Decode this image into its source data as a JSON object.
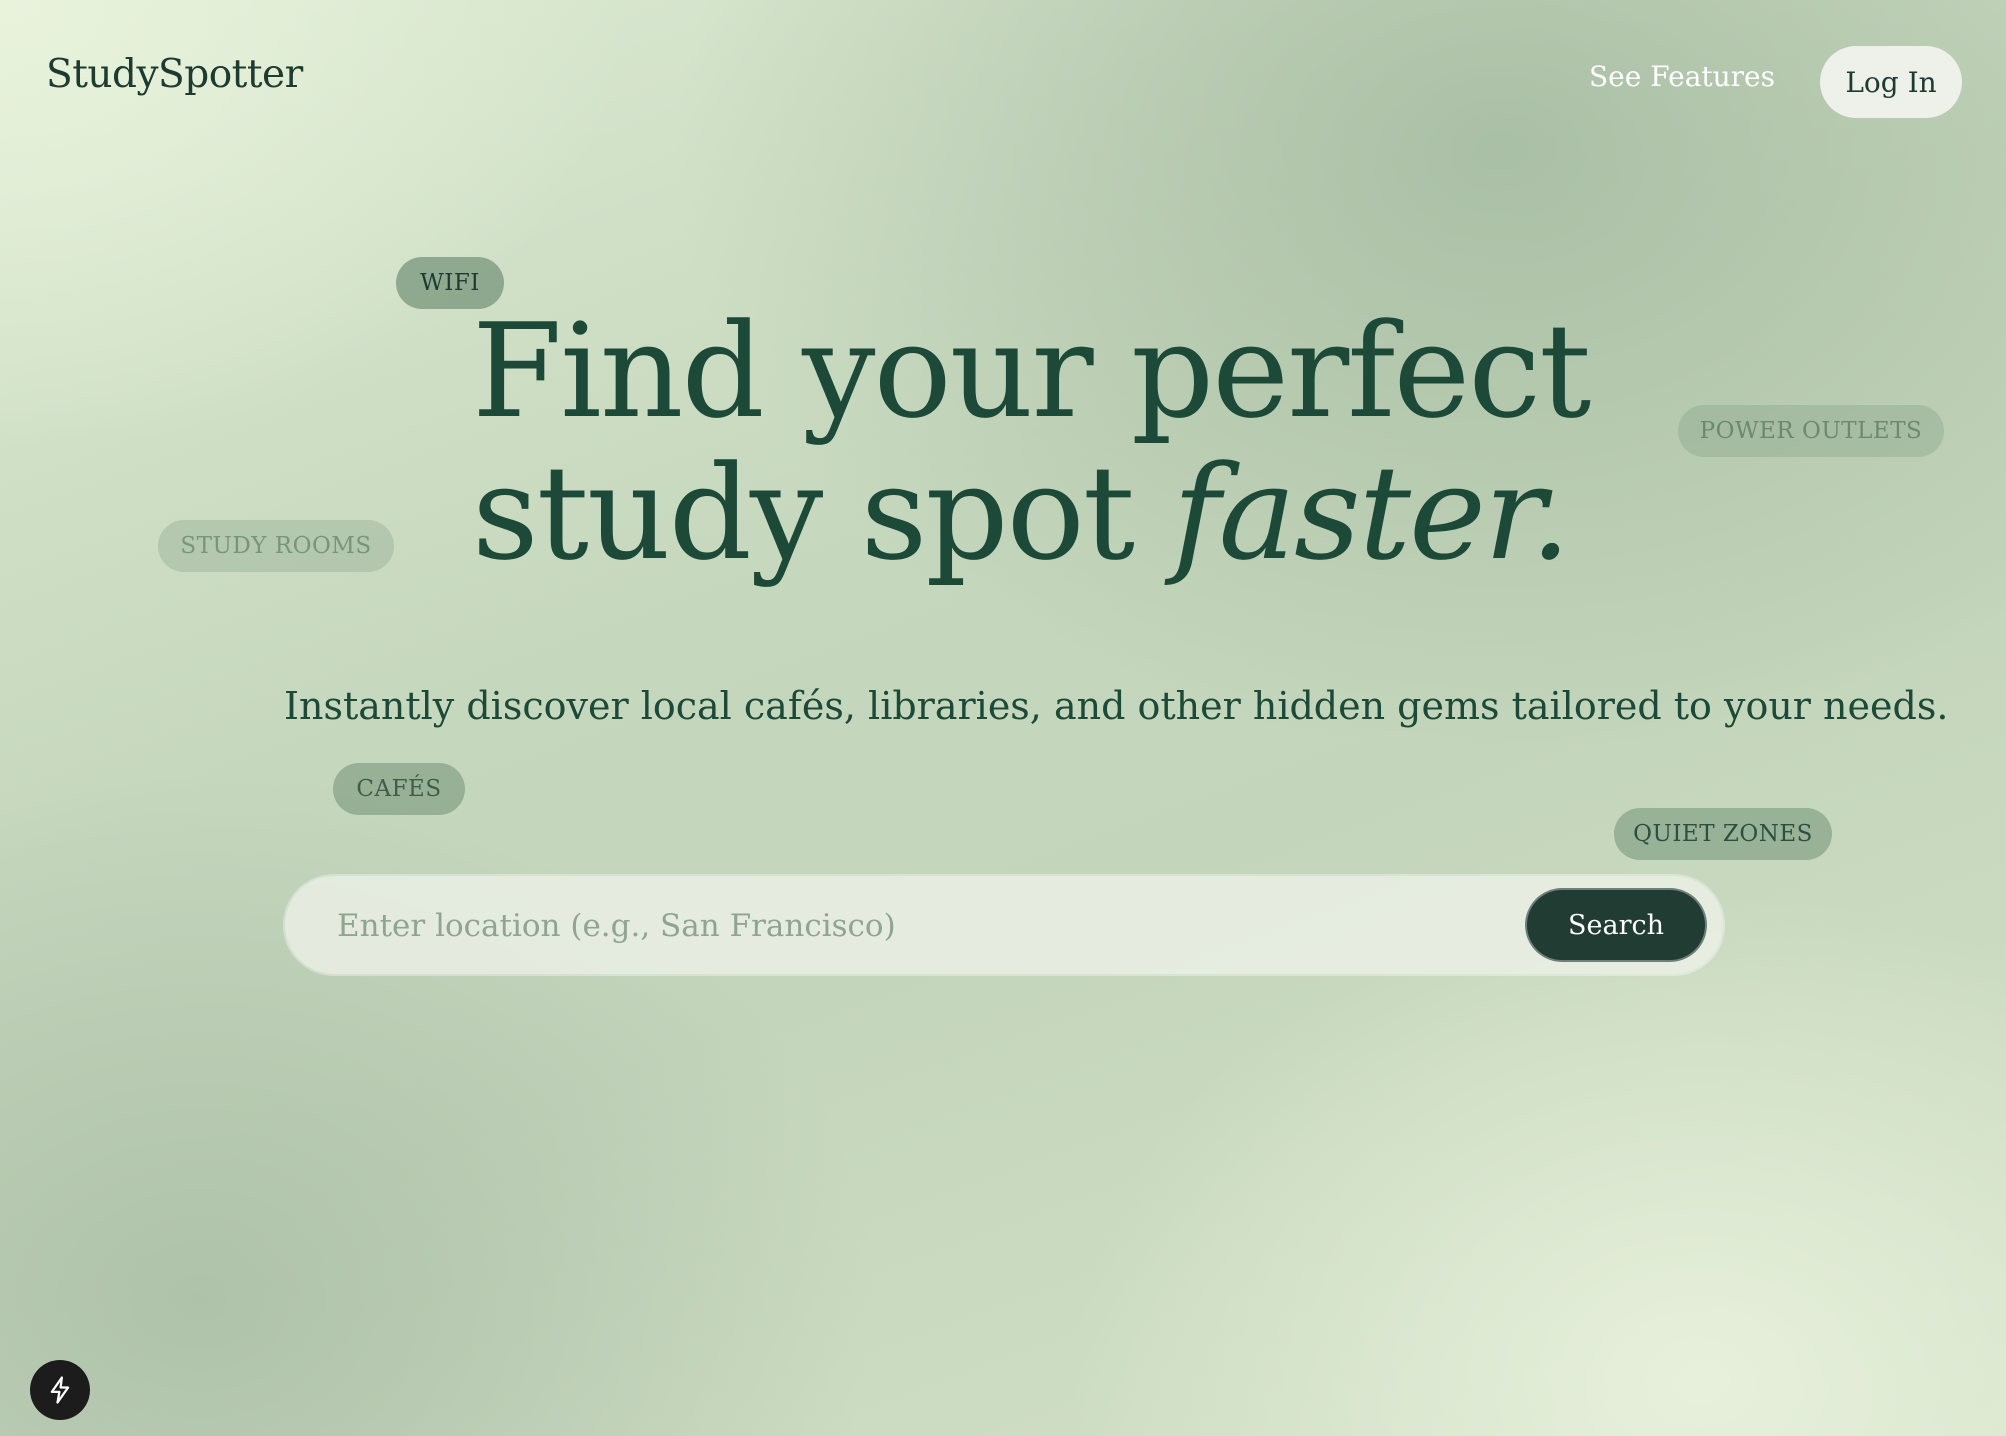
{
  "header": {
    "logo": "StudySpotter",
    "nav_features": "See Features",
    "login_label": "Log In"
  },
  "tags": {
    "wifi": "WIFI",
    "power_outlets": "POWER OUTLETS",
    "study_rooms": "STUDY ROOMS",
    "cafes": "CAFÉS",
    "quiet_zones": "QUIET ZONES"
  },
  "hero": {
    "headline_line1": "Find your perfect",
    "headline_line2_plain": "study spot ",
    "headline_line2_italic": "faster.",
    "subtitle": "Instantly discover local cafés, libraries, and other hidden gems tailored to your needs."
  },
  "search": {
    "value": "",
    "placeholder": "Enter location (e.g., San Francisco)",
    "button_label": "Search"
  },
  "floating_button": {
    "icon": "lightning-bolt-icon"
  }
}
